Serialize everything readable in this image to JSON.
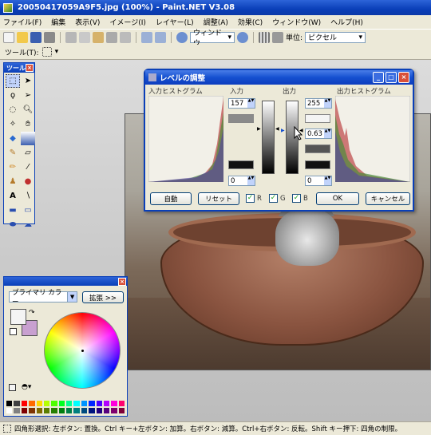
{
  "window": {
    "title": "20050417059A9F5.jpg (100%) - Paint.NET V3.08"
  },
  "menu": [
    "ファイル(F)",
    "編集",
    "表示(V)",
    "イメージ(I)",
    "レイヤー(L)",
    "調整(A)",
    "効果(C)",
    "ウィンドウ(W)",
    "ヘルプ(H)"
  ],
  "toolbar": {
    "zoom_combo": "ウィンドウ",
    "units_label": "単位:",
    "units_value": "ピクセル"
  },
  "toolbar2": {
    "tool_label": "ツール(T):"
  },
  "tools_window": {
    "title": "ツール"
  },
  "colors_window": {
    "primary_select": "プライマリ カラー",
    "expand_button": "拡張 >>"
  },
  "levels": {
    "title": "レベルの調整",
    "input_hist_label": "入力ヒストグラム",
    "input_label": "入力",
    "output_label": "出力",
    "output_hist_label": "出力ヒストグラム",
    "input_high": "157",
    "input_low": "0",
    "output_high": "255",
    "output_gamma": "0.63",
    "output_low": "0",
    "auto_button": "自動",
    "reset_button": "リセット",
    "r_label": "R",
    "g_label": "G",
    "b_label": "B",
    "ok_button": "OK",
    "cancel_button": "キャンセル"
  },
  "status": {
    "text": "四角形選択: 左ボタン: 置換。Ctrl キー+左ボタン: 加算。右ボタン: 減算。Ctrl+右ボタン: 反転。Shift キー押下: 四角の制限。"
  },
  "palette_colors": [
    "#000000",
    "#404040",
    "#ff0000",
    "#ff6a00",
    "#ffd800",
    "#b6ff00",
    "#4cff00",
    "#00ff21",
    "#00ff90",
    "#00ffff",
    "#0094ff",
    "#0026ff",
    "#4800ff",
    "#b200ff",
    "#ff00dc",
    "#ff006e",
    "#ffffff",
    "#808080",
    "#7f0000",
    "#7f3300",
    "#7f6a00",
    "#5b7f00",
    "#267f00",
    "#007f0e",
    "#007f46",
    "#007f7f",
    "#004a7f",
    "#00137f",
    "#21007f",
    "#57007f",
    "#7f006e",
    "#7f0037"
  ]
}
